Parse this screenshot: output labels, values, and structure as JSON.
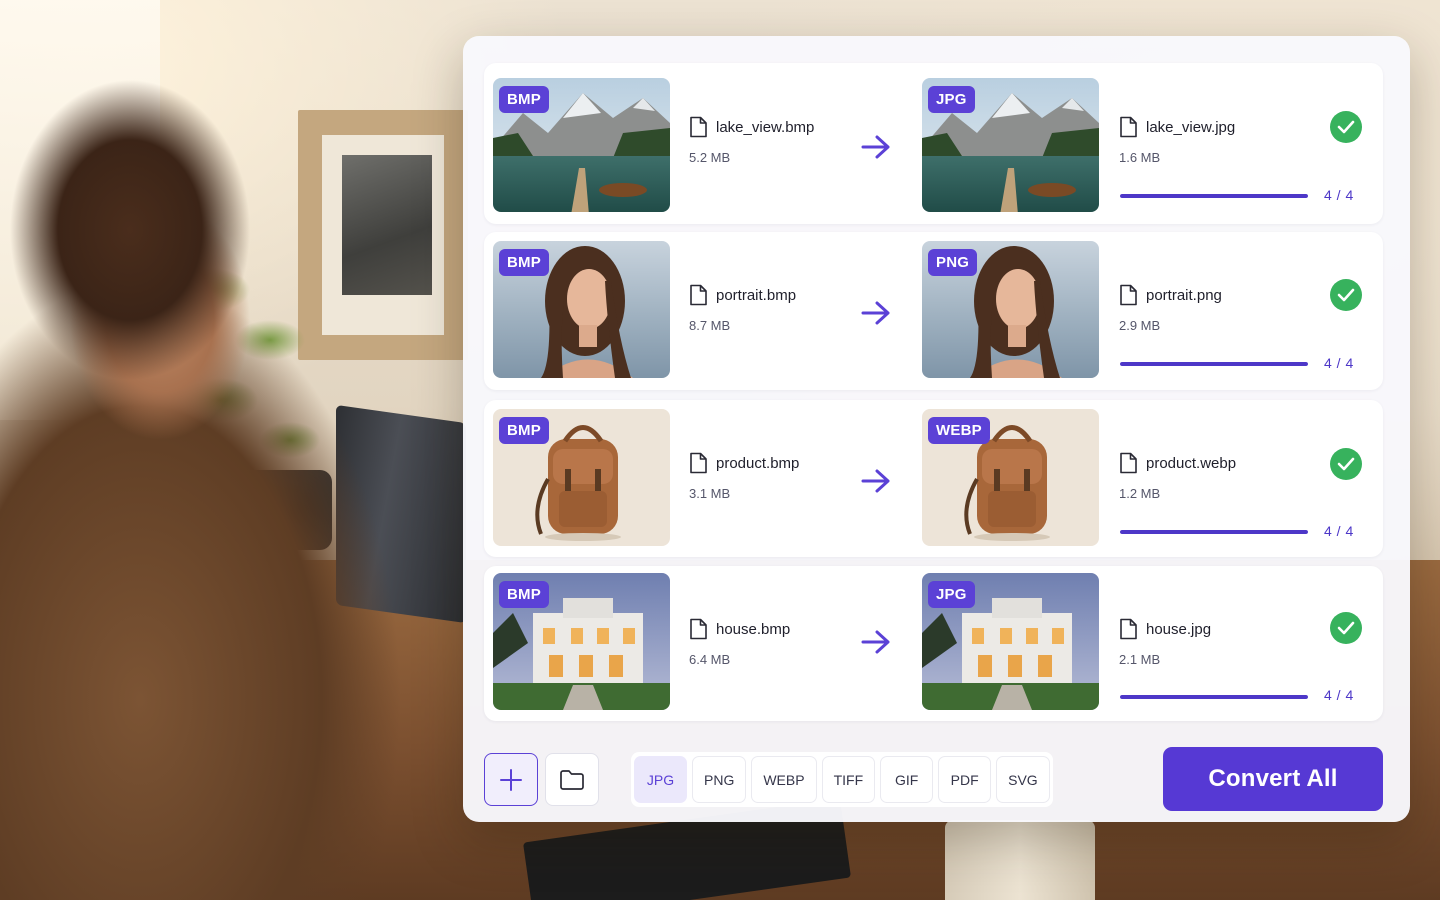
{
  "files": [
    {
      "source": {
        "format": "BMP",
        "name": "lake_view.bmp",
        "size": "5.2 MB",
        "image": "lake-with-dock-image"
      },
      "target": {
        "format": "JPG",
        "name": "lake_view.jpg",
        "size": "1.6 MB",
        "image": "lake-with-dock-image"
      },
      "progress": {
        "fraction": 1.0,
        "label": "4 / 4"
      },
      "status": "done"
    },
    {
      "source": {
        "format": "BMP",
        "name": "portrait.bmp",
        "size": "8.7 MB",
        "image": "portrait-image"
      },
      "target": {
        "format": "PNG",
        "name": "portrait.png",
        "size": "2.9 MB",
        "image": "portrait-image"
      },
      "progress": {
        "fraction": 1.0,
        "label": "4 / 4"
      },
      "status": "done"
    },
    {
      "source": {
        "format": "BMP",
        "name": "product.bmp",
        "size": "3.1 MB",
        "image": "backpack-image"
      },
      "target": {
        "format": "WEBP",
        "name": "product.webp",
        "size": "1.2 MB",
        "image": "backpack-image"
      },
      "progress": {
        "fraction": 1.0,
        "label": "4 / 4"
      },
      "status": "done"
    },
    {
      "source": {
        "format": "BMP",
        "name": "house.bmp",
        "size": "6.4 MB",
        "image": "house-image"
      },
      "target": {
        "format": "JPG",
        "name": "house.jpg",
        "size": "2.1 MB",
        "image": "house-image"
      },
      "progress": {
        "fraction": 1.0,
        "label": "4 / 4"
      },
      "status": "done"
    }
  ],
  "toolbar": {
    "add_icon": "plus-icon",
    "folder_icon": "folder-icon",
    "formats": [
      "JPG",
      "PNG",
      "WEBP",
      "TIFF",
      "GIF",
      "PDF",
      "SVG"
    ],
    "selected_format": "JPG",
    "convert_label": "Convert All"
  },
  "colors": {
    "accent": "#5b41d6",
    "success": "#37b25d",
    "progress": "#4d37c8"
  }
}
